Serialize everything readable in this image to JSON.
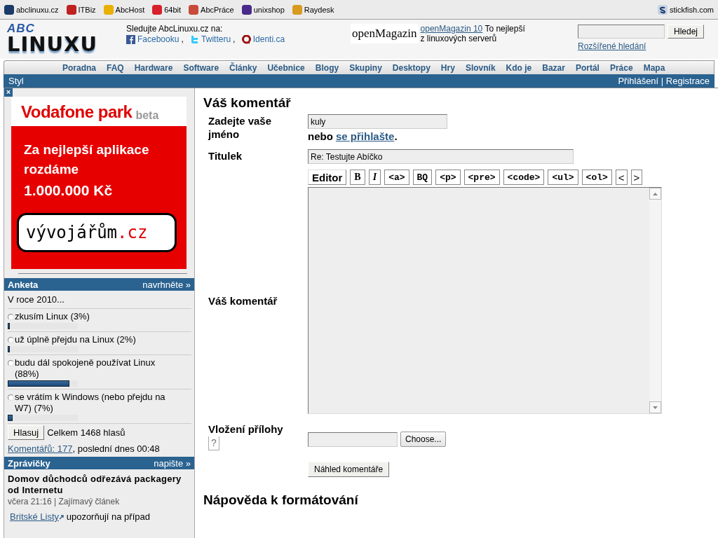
{
  "bookmarks": [
    {
      "label": "abclinuxu.cz",
      "color": "#1a3a6a"
    },
    {
      "label": "ITBiz",
      "color": "#c02020"
    },
    {
      "label": "AbcHost",
      "color": "#e8b000"
    },
    {
      "label": "64bit",
      "color": "#d8202a"
    },
    {
      "label": "AbcPráce",
      "color": "#c84a3a"
    },
    {
      "label": "unixshop",
      "color": "#4a2a8a"
    },
    {
      "label": "Raydesk",
      "color": "#d89a20"
    }
  ],
  "bookmark_right": {
    "label": "stickfish.com"
  },
  "logo": {
    "top": "ABC",
    "bottom": "LINUXU"
  },
  "follow": {
    "title": "Sledujte AbcLinuxu.cz na:",
    "links": [
      {
        "label": "Facebooku",
        "kind": "facebook",
        "sep": ","
      },
      {
        "label": "Twitteru",
        "kind": "twitter",
        "sep": ","
      },
      {
        "label": "Identi.ca",
        "kind": "identica"
      }
    ]
  },
  "promo": {
    "logo": "openMagazin",
    "link": "openMagazin 10",
    "text": "To nejlepší z linuxových serverů"
  },
  "search": {
    "button": "Hledej",
    "advanced": "Rozšířené hledání"
  },
  "nav": [
    "Poradna",
    "FAQ",
    "Hardware",
    "Software",
    "Články",
    "Učebnice",
    "Blogy",
    "Skupiny",
    "Desktopy",
    "Hry",
    "Slovník",
    "Kdo je",
    "Bazar",
    "Portál",
    "Práce",
    "Mapa"
  ],
  "subbar": {
    "left": "Styl",
    "login": "Přihlášení",
    "sep": "|",
    "register": "Registrace"
  },
  "ad": {
    "close": "×",
    "brand": "Vodafone park",
    "tag": "beta",
    "headline": "Za nejlepší aplikace rozdáme",
    "amount": "1.000.000 Kč",
    "site": "vývojářům",
    "tld": ".cz"
  },
  "poll": {
    "title": "Anketa",
    "action": "navrhněte »",
    "question": "V roce 2010...",
    "options": [
      {
        "label": "zkusím Linux (3%)",
        "level": 0.03,
        "selected": false
      },
      {
        "label": "už úplně přejdu na Linux (2%)",
        "level": 0.02,
        "selected": false
      },
      {
        "label": "budu dál spokojeně používat Linux (88%)",
        "level": 0.88,
        "selected": false
      },
      {
        "label": "se vrátím k Windows (nebo přejdu na W7) (7%)",
        "level": 0.07,
        "selected": false
      }
    ],
    "vote": "Hlasuj",
    "total": "Celkem 1468 hlasů",
    "comments_link": "Komentářů: 177",
    "comments_rest": ", poslední dnes 00:48"
  },
  "news": {
    "title": "Zprávičky",
    "action": "napište »",
    "headline": "Domov důchodců odřezává packagery od Internetu",
    "meta": "včera 21:16 | Zajímavý článek",
    "link": "Britské Listy",
    "text": "upozorňují na případ"
  },
  "form": {
    "heading": "Váš komentář",
    "name_label": "Zadejte vaše jméno",
    "name_value": "kuly",
    "or": "nebo",
    "login_link": "se přihlašte",
    "dot": ".",
    "title_label": "Titulek",
    "title_value": "Re: Testujte Abíčko",
    "toolbar": [
      {
        "label": "Editor",
        "kind": "sans"
      },
      {
        "label": "B",
        "kind": "bold"
      },
      {
        "label": "I",
        "kind": "italic"
      },
      {
        "label": "<a>",
        "kind": "code"
      },
      {
        "label": "BQ",
        "kind": "code"
      },
      {
        "label": "<p>",
        "kind": "code"
      },
      {
        "label": "<pre>",
        "kind": "code"
      },
      {
        "label": "<code>",
        "kind": "code"
      },
      {
        "label": "<ul>",
        "kind": "code"
      },
      {
        "label": "<ol>",
        "kind": "code"
      },
      {
        "label": "<",
        "kind": "plain"
      },
      {
        "label": ">",
        "kind": "plain"
      }
    ],
    "comment_label": "Váš komentář",
    "attach_label": "Vložení přílohy",
    "help": "?",
    "choose": "Choose...",
    "preview": "Náhled komentáře"
  },
  "help_heading": "Nápověda k formátování"
}
